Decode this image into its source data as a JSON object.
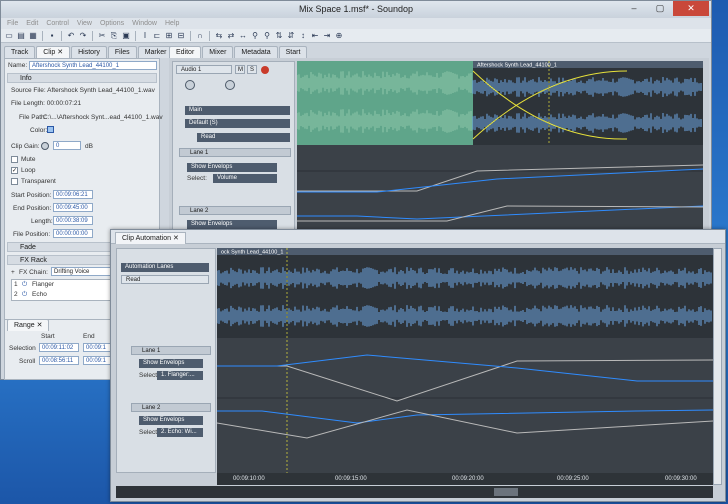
{
  "window": {
    "title": "Mix Space 1.msf* - Soundop",
    "controls": [
      "–",
      "▢",
      "✕"
    ]
  },
  "menu": [
    "File",
    "Edit",
    "Control",
    "View",
    "Options",
    "Window",
    "Help"
  ],
  "left_tabs": [
    "Track",
    "Clip",
    "History",
    "Files",
    "Marker"
  ],
  "editor_tabs": [
    "Editor",
    "Mixer",
    "Metadata",
    "Start"
  ],
  "clip": {
    "name_label": "Name:",
    "name_value": "Aftershock Synth Lead_44100_1",
    "info_header": "Info",
    "source_file": "Source File: Aftershock Synth Lead_44100_1.wav",
    "file_length": "File Length: 00:00:07:21",
    "file_path_label": "File Path:",
    "file_path_value": "C:\\...\\Aftershock Synt...ead_44100_1.wav",
    "color_label": "Color:",
    "clip_gain_label": "Clip Gain:",
    "clip_gain_value": "0",
    "clip_gain_unit": "dB",
    "mute": "Mute",
    "loop": "Loop",
    "transparent": "Transparent",
    "start_position_label": "Start Position:",
    "start_position": "00:09:06:21",
    "end_position_label": "End Position:",
    "end_position": "00:09:45:00",
    "length_label": "Length:",
    "length": "00:00:38:09",
    "file_position_label": "File Position:",
    "file_position": "00:00:00:00",
    "fade_header": "Fade",
    "fx_header": "FX Rack",
    "fx_chain_label": "FX Chain:",
    "fx_chain_value": "Drifting Voice",
    "fx_items": [
      {
        "num": "1",
        "name": "Flanger"
      },
      {
        "num": "2",
        "name": "Echo"
      }
    ]
  },
  "range": {
    "tab": "Range",
    "start_col": "Start",
    "end_col": "End",
    "selection_label": "Selection",
    "selection_start": "00:09:11:02",
    "selection_end": "00:09:1",
    "scroll_label": "Scroll",
    "scroll_start": "00:08:56:11",
    "scroll_end": "00:09:1"
  },
  "track": {
    "name": "Audio 1",
    "m": "M",
    "s": "S",
    "bus": "Main",
    "input": "Default (S)",
    "automation_mode": "Read",
    "clip_label": "Aftershock Synth Lead_44100_1",
    "lane1": "Lane 1",
    "lane1_show": "Show Envelops",
    "lane1_select_label": "Select:",
    "lane1_select": "Volume",
    "lane2": "Lane 2",
    "lane2_show": "Show Envelops"
  },
  "automation": {
    "tab": "Clip Automation",
    "lanes_dropdown": "Automation Lanes",
    "mode": "Read",
    "clip_label": "ock Synth Lead_44100_1",
    "lane1": "Lane 1",
    "lane1_show": "Show Envelops",
    "lane1_select_label": "Select:",
    "lane1_select": "1. Flanger:...",
    "lane2": "Lane 2",
    "lane2_show": "Show Envelops",
    "lane2_select_label": "Select:",
    "lane2_select": "2. Echo: Wi...",
    "ruler": [
      "00:09:10:00",
      "00:09:15:00",
      "00:09:20:00",
      "00:09:25:00",
      "00:09:30:00"
    ]
  },
  "colors": {
    "envelope_blue": "#2f8cff",
    "envelope_gray": "#b9b9b9",
    "wave_blue": "#6ea8e8",
    "wave_green": "#5fa58a",
    "crossfade_yellow": "#e8e23a"
  }
}
